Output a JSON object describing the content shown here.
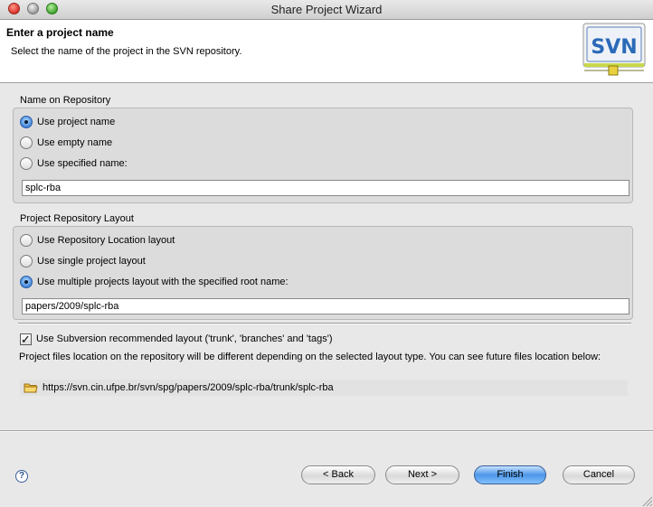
{
  "window": {
    "title": "Share Project Wizard"
  },
  "header": {
    "title": "Enter a project name",
    "description": "Select the name of the project in the SVN repository.",
    "logo_text": "SVN"
  },
  "name_group": {
    "label": "Name on Repository",
    "options": [
      {
        "label": "Use project name",
        "selected": true
      },
      {
        "label": "Use empty name",
        "selected": false
      },
      {
        "label": "Use specified name:",
        "selected": false
      }
    ],
    "specified_name_value": "splc-rba"
  },
  "layout_group": {
    "label": "Project Repository Layout",
    "options": [
      {
        "label": "Use Repository Location layout",
        "selected": false
      },
      {
        "label": "Use single project layout",
        "selected": false
      },
      {
        "label": "Use multiple projects layout with the specified root name:",
        "selected": true
      }
    ],
    "root_name_value": "papers/2009/splc-rba"
  },
  "recommended_layout": {
    "label": "Use Subversion recommended layout ('trunk', 'branches' and 'tags')",
    "checked": true
  },
  "info_text": "Project files location on the repository will be different depending on the selected layout type. You can see future files location below:",
  "location_path": "https://svn.cin.ufpe.br/svn/spg/papers/2009/splc-rba/trunk/splc-rba",
  "buttons": {
    "back": "< Back",
    "next": "Next >",
    "finish": "Finish",
    "cancel": "Cancel",
    "help": "?"
  }
}
